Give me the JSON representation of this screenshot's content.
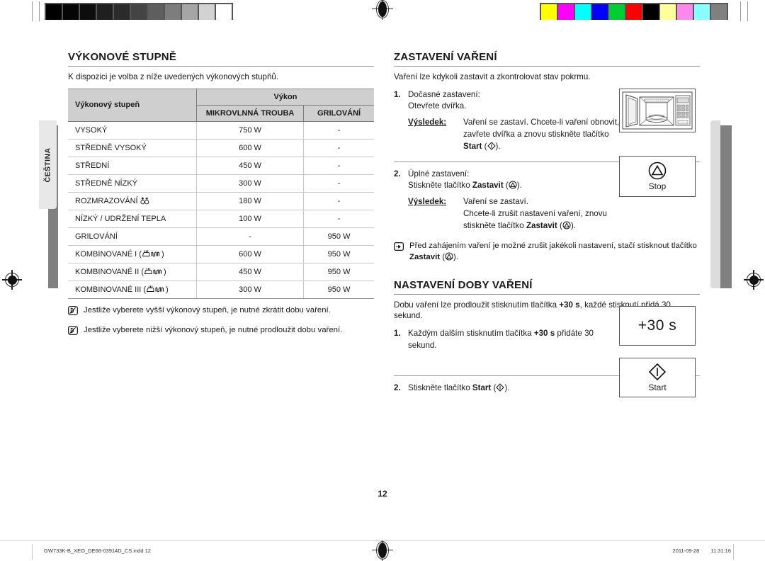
{
  "page": {
    "number": "12",
    "language_tab": "ČEŠTINA"
  },
  "colorbars": {
    "grey": [
      "#000000",
      "#050505",
      "#0d0d0d",
      "#1f1f1f",
      "#2b2b2b",
      "#444444",
      "#5e5e5e",
      "#7d7d7d",
      "#a5a5a5",
      "#d2d2d2",
      "#ffffff"
    ],
    "color": [
      "#ffff00",
      "#ff00ff",
      "#00ffff",
      "#0000ff",
      "#00cc33",
      "#ff0000",
      "#000000",
      "#ffff99",
      "#ff88ee",
      "#88ffff",
      "#808080"
    ]
  },
  "left_column": {
    "title": "VÝKONOVÉ STUPNĚ",
    "intro": "K dispozici je volba z níže uvedených výkonových stupňů.",
    "table": {
      "header_level": "Výkonový stupeň",
      "header_power": "Výkon",
      "header_microwave": "MIKROVLNNÁ TROUBA",
      "header_grill": "GRILOVÁNÍ",
      "rows": [
        {
          "level": "VYSOKÝ",
          "icon": "",
          "microwave": "750 W",
          "grill": "-"
        },
        {
          "level": "STŘEDNĚ VYSOKÝ",
          "icon": "",
          "microwave": "600 W",
          "grill": "-"
        },
        {
          "level": "STŘEDNÍ",
          "icon": "",
          "microwave": "450 W",
          "grill": "-"
        },
        {
          "level": "STŘEDNĚ NÍZKÝ",
          "icon": "",
          "microwave": "300 W",
          "grill": "-"
        },
        {
          "level": "ROZMRAZOVÁNÍ",
          "icon": "defrost-icon",
          "microwave": "180 W",
          "grill": "-"
        },
        {
          "level": "NÍZKÝ / UDRŽENÍ TEPLA",
          "icon": "",
          "microwave": "100 W",
          "grill": "-"
        },
        {
          "level": "GRILOVÁNÍ",
          "icon": "",
          "microwave": "-",
          "grill": "950 W"
        },
        {
          "level": "KOMBINOVANÉ I",
          "icon": "combi-icon",
          "microwave": "600 W",
          "grill": "950 W"
        },
        {
          "level": "KOMBINOVANÉ II",
          "icon": "combi-icon",
          "microwave": "450 W",
          "grill": "950 W"
        },
        {
          "level": "KOMBINOVANÉ III",
          "icon": "combi-icon",
          "microwave": "300 W",
          "grill": "950 W"
        }
      ]
    },
    "notes": [
      "Jestliže vyberete vyšší výkonový stupeň, je nutné zkrátit dobu vaření.",
      "Jestliže vyberete nižší výkonový stupeň, je nutné prodloužit dobu vaření."
    ]
  },
  "right_column": {
    "stop_section": {
      "title": "ZASTAVENÍ VAŘENÍ",
      "intro": "Vaření lze kdykoli zastavit a zkontrolovat stav pokrmu.",
      "step1": {
        "num": "1.",
        "line1": "Dočasné zastavení:",
        "line2": "Otevřete dvířka.",
        "result_label": "Výsledek:",
        "result_pre": "Vaření se zastaví. Chcete-li vaření obnovit, zavřete dvířka a znovu stiskněte tlačítko ",
        "result_bold": "Start",
        "result_post": " (   )."
      },
      "step2": {
        "num": "2.",
        "line1": "Úplné zastavení:",
        "line2_pre": "Stiskněte tlačítko ",
        "line2_bold": "Zastavit",
        "line2_post": " (   ).",
        "result_label": "Výsledek:",
        "result_line1": "Vaření se zastaví.",
        "result_line2_pre": "Chcete-li zrušit nastavení vaření, znovu stiskněte tlačítko ",
        "result_line2_bold": "Zastavit",
        "result_line2_post": " (   )."
      },
      "tip_pre": "Před zahájením vaření je možné zrušit jakékoli nastavení, stačí stisknout tlačítko ",
      "tip_bold": "Zastavit",
      "tip_post": " (   ).",
      "stop_button_caption": "Stop"
    },
    "time_section": {
      "title": "NASTAVENÍ DOBY VAŘENÍ",
      "intro_pre": "Dobu vaření lze prodloužit stisknutím tlačítka ",
      "intro_bold": "+30 s",
      "intro_post": ", každé stisknutí přidá 30 sekund.",
      "step1": {
        "num": "1.",
        "pre": "Každým dalším stisknutím tlačítka ",
        "bold": "+30 s",
        "post": " přidáte 30 sekund."
      },
      "step2": {
        "num": "2.",
        "pre": "Stiskněte tlačítko ",
        "bold": "Start",
        "post": " (   )."
      },
      "plus30_button_label": "+30 s",
      "start_button_caption": "Start"
    }
  },
  "footer": {
    "filename": "GW733K-B_XEO_DE68-03914D_CS.indd   12",
    "date": "2011-09-28",
    "time": "11:31:16"
  }
}
